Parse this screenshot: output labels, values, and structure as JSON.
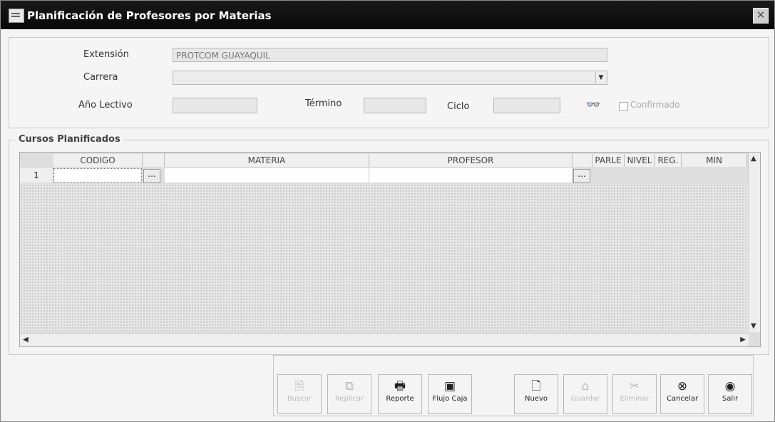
{
  "window": {
    "title": "Planificación de Profesores por Materias",
    "close_glyph": "✕"
  },
  "form": {
    "extension_label": "Extensión",
    "extension_value": "PROTCOM GUAYAQUIL",
    "carrera_label": "Carrera",
    "carrera_value": "",
    "anio_label": "Año Lectivo",
    "anio_value": "",
    "termino_label": "Término",
    "termino_value": "",
    "ciclo_label": "Ciclo",
    "ciclo_value": "",
    "confirmado_label": "Confirmado"
  },
  "group": {
    "title": "Cursos Planificados"
  },
  "grid": {
    "columns": [
      "CODIGO",
      "MATERIA",
      "PROFESOR",
      "PARLE",
      "NIVEL",
      "REG.",
      "MIN"
    ],
    "rows": [
      {
        "num": "1",
        "codigo": "",
        "materia": "",
        "profesor": ""
      }
    ],
    "ellipsis": "..."
  },
  "toolbar": {
    "buttons": [
      {
        "label": "Buscar",
        "icon": "search-icon",
        "glyph": "🗎",
        "enabled": false
      },
      {
        "label": "Replicar",
        "icon": "replicate-icon",
        "glyph": "⧉",
        "enabled": false
      },
      {
        "label": "Reporte",
        "icon": "printer-icon",
        "glyph": "🖶",
        "enabled": true
      },
      {
        "label": "Flujo Caja",
        "icon": "cash-flow-icon",
        "glyph": "▣",
        "enabled": true
      },
      {
        "label": "Nuevo",
        "icon": "new-document-icon",
        "glyph": "🗋",
        "enabled": true
      },
      {
        "label": "Guardar",
        "icon": "save-icon",
        "glyph": "⌂",
        "enabled": false
      },
      {
        "label": "Eliminar",
        "icon": "delete-icon",
        "glyph": "✂",
        "enabled": false
      },
      {
        "label": "Cancelar",
        "icon": "cancel-icon",
        "glyph": "⊗",
        "enabled": true
      },
      {
        "label": "Salir",
        "icon": "exit-icon",
        "glyph": "◉",
        "enabled": true
      }
    ]
  }
}
